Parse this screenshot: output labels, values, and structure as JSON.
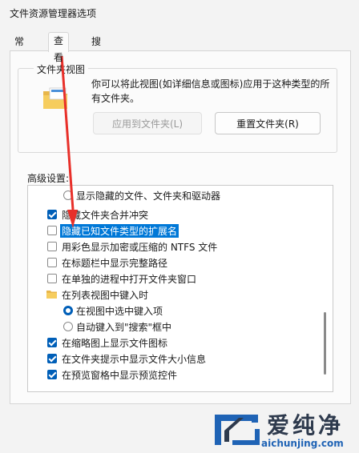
{
  "window": {
    "title": "文件资源管理器选项"
  },
  "tabs": [
    {
      "label": "常规"
    },
    {
      "label": "查看"
    },
    {
      "label": "搜索"
    }
  ],
  "folder_views": {
    "legend": "文件夹视图",
    "description": "你可以将此视图(如详细信息或图标)应用于这种类型的所有文件夹。",
    "apply_label": "应用到文件夹(L)",
    "reset_label": "重置文件夹(R)"
  },
  "advanced": {
    "label": "高级设置:",
    "items": [
      {
        "type": "radio",
        "checked": false,
        "label": "显示隐藏的文件、文件夹和驱动器"
      },
      {
        "type": "checkbox",
        "checked": true,
        "label": "隐藏文件夹合并冲突"
      },
      {
        "type": "checkbox",
        "checked": false,
        "label": "隐藏已知文件类型的扩展名",
        "highlighted": true
      },
      {
        "type": "checkbox",
        "checked": false,
        "label": "用彩色显示加密或压缩的 NTFS 文件"
      },
      {
        "type": "checkbox",
        "checked": false,
        "label": "在标题栏中显示完整路径"
      },
      {
        "type": "checkbox",
        "checked": false,
        "label": "在单独的进程中打开文件夹窗口"
      },
      {
        "type": "folder",
        "label": "在列表视图中键入时"
      },
      {
        "type": "radio",
        "checked": true,
        "label": "在视图中选中键入项"
      },
      {
        "type": "radio",
        "checked": false,
        "label": "自动键入到\"搜索\"框中"
      },
      {
        "type": "checkbox",
        "checked": true,
        "label": "在缩略图上显示文件图标"
      },
      {
        "type": "checkbox",
        "checked": true,
        "label": "在文件夹提示中显示文件大小信息"
      },
      {
        "type": "checkbox",
        "checked": true,
        "label": "在预览窗格中显示预览控件"
      }
    ]
  },
  "watermark": {
    "brand": "爱纯净",
    "url": "aichunjing.com"
  },
  "colors": {
    "accent": "#005fb8",
    "selection": "#0078d7",
    "annotation": "#e8302a"
  }
}
